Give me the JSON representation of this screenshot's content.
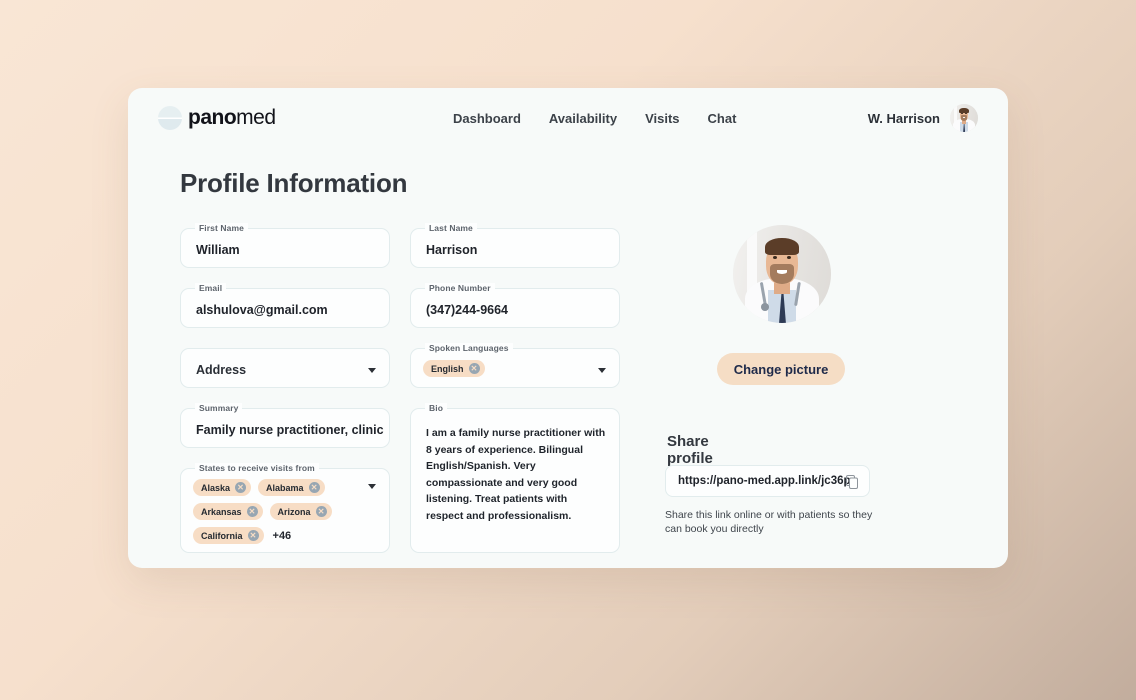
{
  "header": {
    "logo_pano": "pano",
    "logo_med": "med",
    "nav": [
      {
        "label": "Dashboard"
      },
      {
        "label": "Availability"
      },
      {
        "label": "Visits"
      },
      {
        "label": "Chat"
      }
    ],
    "user_name": "W. Harrison"
  },
  "main": {
    "page_title": "Profile Information",
    "fields": {
      "first_name": {
        "label": "First Name",
        "value": "William"
      },
      "last_name": {
        "label": "Last Name",
        "value": "Harrison"
      },
      "email": {
        "label": "Email",
        "value": "alshulova@gmail.com"
      },
      "phone": {
        "label": "Phone Number",
        "value": "(347)244-9664"
      },
      "address": {
        "label": "",
        "placeholder": "Address"
      },
      "spoken_languages": {
        "label": "Spoken Languages",
        "chips": [
          "English"
        ]
      },
      "summary": {
        "label": "Summary",
        "value": "Family nurse practitioner, clinician, u"
      },
      "bio": {
        "label": "Bio",
        "value": "I am a family nurse practitioner with 8 years of experience. Bilingual English/Spanish. Very compassionate and very good listening. Treat patients with respect and professionalism."
      },
      "states": {
        "label": "States to receive visits from",
        "chips": [
          "Alaska",
          "Alabama",
          "Arkansas",
          "Arizona",
          "California"
        ],
        "more": "+46"
      }
    },
    "chip_remove_glyph": "✕"
  },
  "right": {
    "change_picture_label": "Change picture",
    "share_title": "Share profile URL",
    "share_url": "https://pano-med.app.link/jc36p",
    "share_help": "Share this link online or with patients so they can book you directly"
  },
  "colors": {
    "chip_bg": "#f7ddc5",
    "button_bg": "#f5ddc5",
    "button_text": "#1e2a4a",
    "card_bg": "#f7faf9",
    "field_border": "#e2eced"
  }
}
